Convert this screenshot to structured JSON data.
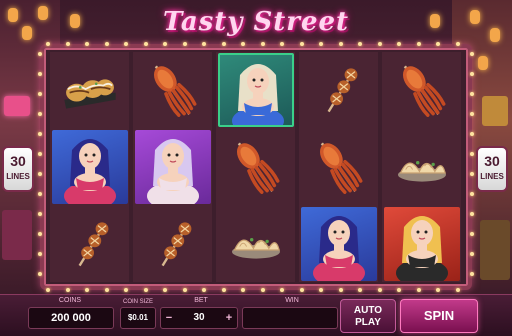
{
  "game": {
    "title": "Tasty Street"
  },
  "lines": {
    "left_count": "30",
    "left_label": "LINES",
    "right_count": "30",
    "right_label": "LINES"
  },
  "reels": [
    [
      "takoyaki",
      "squid",
      "wild-girl",
      "skewer",
      "squid"
    ],
    [
      "blue-girl",
      "purple-girl",
      "squid",
      "squid",
      "dumpling"
    ],
    [
      "skewer",
      "skewer",
      "dumpling",
      "blue-girl",
      "red-girl"
    ]
  ],
  "controls": {
    "coins_label": "COINS",
    "coins_value": "200 000",
    "coin_size_label": "COIN SIZE",
    "coin_size_value": "$0.01",
    "bet_label": "BET",
    "bet_value": "30",
    "bet_minus": "−",
    "bet_plus": "+",
    "win_label": "WIN",
    "win_value": "",
    "auto_play_label": "AUTO\nPLAY",
    "spin_label": "SPIN"
  },
  "colors": {
    "accent": "#e0208c",
    "frame": "#8a3a52",
    "wild": "#2f8a7a"
  }
}
